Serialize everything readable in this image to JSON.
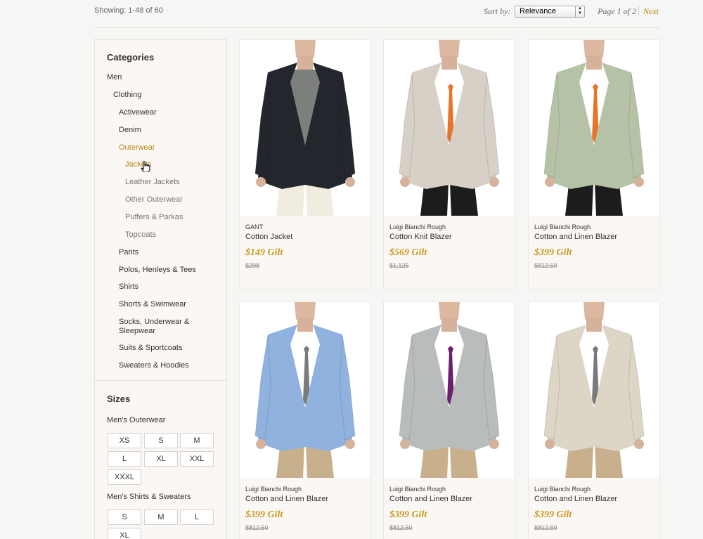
{
  "topbar": {
    "showing": "Showing: 1-48 of 60",
    "sort_label": "Sort by:",
    "sort_value": "Relevance",
    "page_info": "Page 1 of 2",
    "next_label": "Next"
  },
  "sidebar": {
    "categories_title": "Categories",
    "categories": [
      {
        "label": "Men"
      },
      {
        "label": "Clothing"
      },
      {
        "label": "Activewear"
      },
      {
        "label": "Denim"
      },
      {
        "label": "Outerwear"
      },
      {
        "label": "Jackets"
      },
      {
        "label": "Leather Jackets"
      },
      {
        "label": "Other Outerwear"
      },
      {
        "label": "Puffers & Parkas"
      },
      {
        "label": "Topcoats"
      },
      {
        "label": "Pants"
      },
      {
        "label": "Polos, Henleys & Tees"
      },
      {
        "label": "Shirts"
      },
      {
        "label": "Shorts & Swimwear"
      },
      {
        "label": "Socks, Underwear &"
      },
      {
        "label": "Sleepwear"
      },
      {
        "label": "Suits & Sportcoats"
      },
      {
        "label": "Sweaters & Hoodies"
      }
    ],
    "sizes_title": "Sizes",
    "size_groups": [
      {
        "label": "Men's Outerwear",
        "sizes": [
          "XS",
          "S",
          "M",
          "L",
          "XL",
          "XXL",
          "XXXL"
        ]
      },
      {
        "label": "Men's Shirts & Sweaters",
        "sizes": [
          "S",
          "M",
          "L",
          "XL"
        ]
      }
    ]
  },
  "products": [
    {
      "brand": "GANT",
      "name": "Cotton Jacket",
      "price": "$149 Gilt",
      "old_price": "$298",
      "jacket_color": "#23272d",
      "tie_color": "none",
      "pants_color": "#f1ece0",
      "shirt_color": "#7d7f7c"
    },
    {
      "brand": "Luigi Bianchi Rough",
      "name": "Cotton Knit Blazer",
      "price": "$569 Gilt",
      "old_price": "$1,125",
      "jacket_color": "#d6d0c6",
      "tie_color": "#e8742a",
      "pants_color": "#1c1c1c",
      "shirt_color": "#ffffff"
    },
    {
      "brand": "Luigi Bianchi Rough",
      "name": "Cotton and Linen Blazer",
      "price": "$399 Gilt",
      "old_price": "$812.50",
      "jacket_color": "#b6c2a6",
      "tie_color": "#e8742a",
      "pants_color": "#1c1c1c",
      "shirt_color": "#ffffff"
    },
    {
      "brand": "Luigi Bianchi Rough",
      "name": "Cotton and Linen Blazer",
      "price": "$399 Gilt",
      "old_price": "$812.50",
      "jacket_color": "#8fb3de",
      "tie_color": "#7a7a7a",
      "pants_color": "#c9b08c",
      "shirt_color": "#ffffff"
    },
    {
      "brand": "Luigi Bianchi Rough",
      "name": "Cotton and Linen Blazer",
      "price": "$399 Gilt",
      "old_price": "$812.50",
      "jacket_color": "#b9bcbd",
      "tie_color": "#6b1f6e",
      "pants_color": "#c9b08c",
      "shirt_color": "#ffffff"
    },
    {
      "brand": "Luigi Bianchi Rough",
      "name": "Cotton and Linen Blazer",
      "price": "$399 Gilt",
      "old_price": "$812.50",
      "jacket_color": "#ddd6c6",
      "tie_color": "#7a7a7a",
      "pants_color": "#c9b08c",
      "shirt_color": "#ffffff"
    }
  ]
}
